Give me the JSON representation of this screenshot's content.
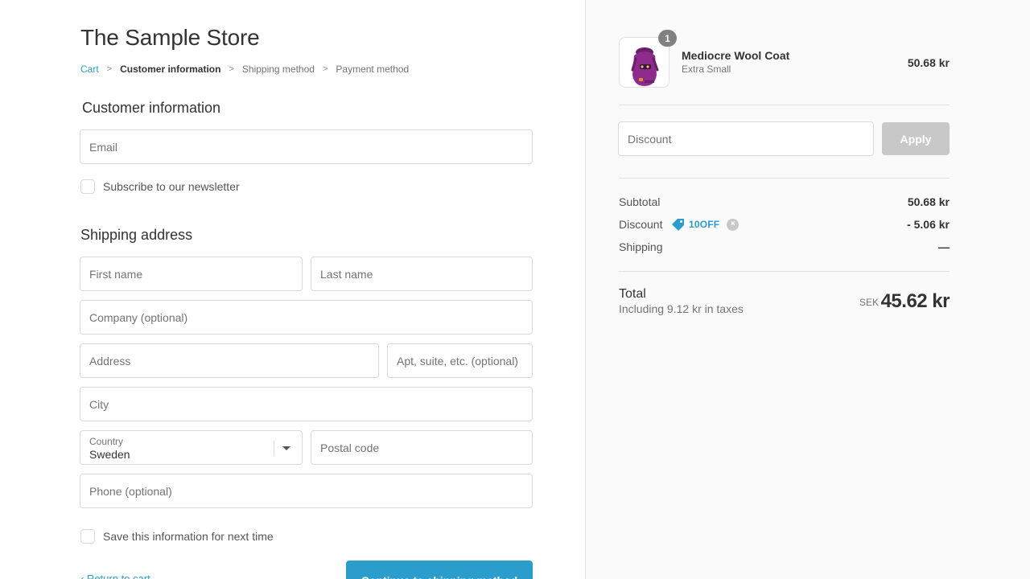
{
  "store": {
    "title": "The Sample Store"
  },
  "breadcrumb": {
    "items": [
      "Cart",
      "Customer information",
      "Shipping method",
      "Payment method"
    ],
    "separator": ">"
  },
  "customer_info": {
    "heading": "Customer information",
    "email_placeholder": "Email",
    "newsletter_label": "Subscribe to our newsletter"
  },
  "shipping_address": {
    "heading": "Shipping address",
    "first_name_placeholder": "First name",
    "last_name_placeholder": "Last name",
    "company_placeholder": "Company (optional)",
    "address_placeholder": "Address",
    "apt_placeholder": "Apt, suite, etc. (optional)",
    "city_placeholder": "City",
    "country_label": "Country",
    "country_value": "Sweden",
    "postal_placeholder": "Postal code",
    "phone_placeholder": "Phone (optional)",
    "save_info_label": "Save this information for next time"
  },
  "actions": {
    "continue_label": "Continue to shipping method",
    "return_label": "‹ Return to cart"
  },
  "order": {
    "product": {
      "quantity": "1",
      "name": "Mediocre Wool Coat",
      "variant": "Extra Small",
      "price": "50.68 kr"
    },
    "discount_placeholder": "Discount",
    "apply_label": "Apply",
    "subtotal_label": "Subtotal",
    "subtotal_value": "50.68 kr",
    "discount_label": "Discount",
    "discount_code": "10OFF",
    "discount_value": "- 5.06 kr",
    "shipping_label": "Shipping",
    "shipping_value": "—",
    "total_label": "Total",
    "tax_note": "Including 9.12 kr in taxes",
    "currency": "SEK",
    "total_value": "45.62 kr"
  },
  "colors": {
    "accent": "#2a9dcc",
    "product_purple": "#8e2c8e"
  }
}
